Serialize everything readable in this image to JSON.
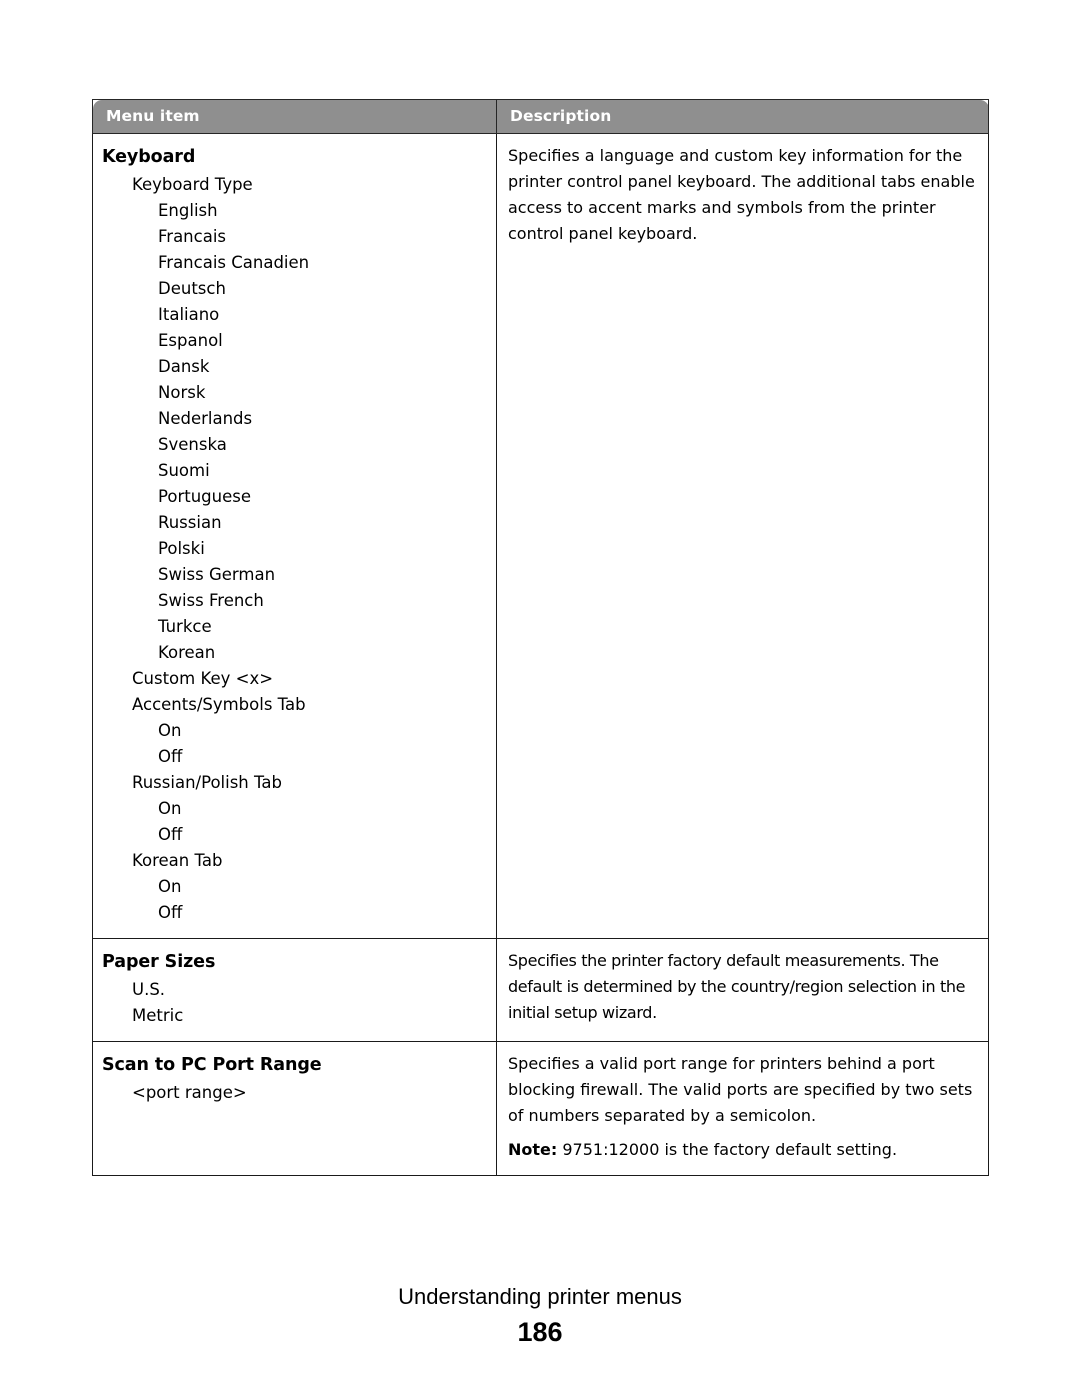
{
  "table": {
    "columns": [
      {
        "key": "menu_item",
        "label": "Menu item"
      },
      {
        "key": "description",
        "label": "Description"
      }
    ],
    "header_bg": "#8f8f8f",
    "header_text_color": "#ffffff",
    "border_color": "#1a1a1a",
    "rows": [
      {
        "menu_items": [
          {
            "level": 0,
            "label": "Keyboard"
          },
          {
            "level": 1,
            "label": "Keyboard Type"
          },
          {
            "level": 2,
            "label": "English"
          },
          {
            "level": 2,
            "label": "Francais"
          },
          {
            "level": 2,
            "label": "Francais Canadien"
          },
          {
            "level": 2,
            "label": "Deutsch"
          },
          {
            "level": 2,
            "label": "Italiano"
          },
          {
            "level": 2,
            "label": "Espanol"
          },
          {
            "level": 2,
            "label": "Dansk"
          },
          {
            "level": 2,
            "label": "Norsk"
          },
          {
            "level": 2,
            "label": "Nederlands"
          },
          {
            "level": 2,
            "label": "Svenska"
          },
          {
            "level": 2,
            "label": "Suomi"
          },
          {
            "level": 2,
            "label": "Portuguese"
          },
          {
            "level": 2,
            "label": "Russian"
          },
          {
            "level": 2,
            "label": "Polski"
          },
          {
            "level": 2,
            "label": "Swiss German"
          },
          {
            "level": 2,
            "label": "Swiss French"
          },
          {
            "level": 2,
            "label": "Turkce"
          },
          {
            "level": 2,
            "label": "Korean"
          },
          {
            "level": 1,
            "label": "Custom Key <x>"
          },
          {
            "level": 1,
            "label": "Accents/Symbols Tab"
          },
          {
            "level": 2,
            "label": "On"
          },
          {
            "level": 2,
            "label": "Off"
          },
          {
            "level": 1,
            "label": "Russian/Polish Tab"
          },
          {
            "level": 2,
            "label": "On"
          },
          {
            "level": 2,
            "label": "Off"
          },
          {
            "level": 1,
            "label": "Korean Tab"
          },
          {
            "level": 2,
            "label": "On"
          },
          {
            "level": 2,
            "label": "Off"
          }
        ],
        "description": [
          {
            "text": "Specifies a language and custom key information for the printer control panel keyboard. The additional tabs enable access to accent marks and symbols from the printer control panel keyboard."
          }
        ]
      },
      {
        "menu_items": [
          {
            "level": 0,
            "label": "Paper Sizes"
          },
          {
            "level": 1,
            "label": "U.S."
          },
          {
            "level": 1,
            "label": "Metric"
          }
        ],
        "description": [
          {
            "text": "Specifies the printer factory default measurements. The default is determined by the country/region selection in the initial setup wizard.",
            "tight": true
          }
        ]
      },
      {
        "menu_items": [
          {
            "level": 0,
            "label": "Scan to PC Port Range"
          },
          {
            "level": 1,
            "label": "<port range>"
          }
        ],
        "description": [
          {
            "text": "Specifies a valid port range for printers behind a port blocking firewall. The valid ports are specified by two sets of numbers separated by a semicolon."
          },
          {
            "note_label": "Note:",
            "text": " 9751:12000 is the factory default setting."
          }
        ]
      }
    ]
  },
  "footer": {
    "title": "Understanding printer menus",
    "page_number": "186"
  }
}
